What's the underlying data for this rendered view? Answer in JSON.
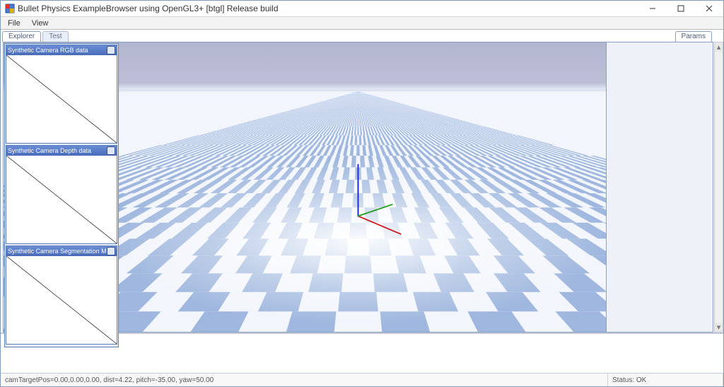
{
  "window": {
    "title": "Bullet Physics ExampleBrowser using OpenGL3+ [btgl] Release build"
  },
  "menu": {
    "file": "File",
    "view": "View"
  },
  "tabs": {
    "explorer": "Explorer",
    "test": "Test",
    "params": "Params"
  },
  "explorer": {
    "panels": [
      {
        "title": "Synthetic Camera RGB data"
      },
      {
        "title": "Synthetic Camera Depth data"
      },
      {
        "title": "Synthetic Camera Segmentation Mask"
      }
    ]
  },
  "status": {
    "left": "camTargetPos=0.00,0.00,0.00, dist=4.22, pitch=-35.00, yaw=50.00",
    "right": "Status: OK"
  },
  "scene": {
    "axes": {
      "x": "#d02020",
      "y": "#20a020",
      "z": "#2030d0"
    },
    "horizon_frac": 0.17
  }
}
